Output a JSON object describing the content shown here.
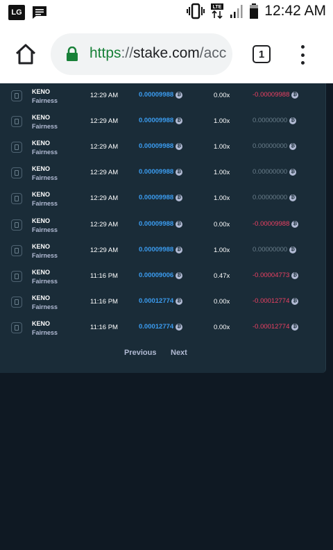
{
  "statusbar": {
    "lg_badge": "LG",
    "time": "12:42 AM",
    "icons": [
      "message-icon",
      "vibrate-icon",
      "lte-icon",
      "signal-icon",
      "battery-icon"
    ]
  },
  "browser": {
    "url_scheme": "https",
    "url_sep": "://",
    "url_host": "stake.com",
    "url_path": "/acc",
    "tab_count": "1",
    "icons": [
      "home-icon",
      "lock-icon",
      "tabs-icon",
      "overflow-menu-icon"
    ]
  },
  "colors": {
    "bet_amount": "#3b9cf0",
    "loss": "#ed4163",
    "neutral": "#b1bad3",
    "panel_bg": "#1a2c38",
    "page_bg": "#0f1923"
  },
  "bets": [
    {
      "game": "KENO",
      "link": "Fairness",
      "time": "12:29 AM",
      "amount": "0.00009988",
      "multiplier": "0.00x",
      "payout": "-0.00009988",
      "loss": true
    },
    {
      "game": "KENO",
      "link": "Fairness",
      "time": "12:29 AM",
      "amount": "0.00009988",
      "multiplier": "1.00x",
      "payout": "0.00000000",
      "loss": false
    },
    {
      "game": "KENO",
      "link": "Fairness",
      "time": "12:29 AM",
      "amount": "0.00009988",
      "multiplier": "1.00x",
      "payout": "0.00000000",
      "loss": false
    },
    {
      "game": "KENO",
      "link": "Fairness",
      "time": "12:29 AM",
      "amount": "0.00009988",
      "multiplier": "1.00x",
      "payout": "0.00000000",
      "loss": false
    },
    {
      "game": "KENO",
      "link": "Fairness",
      "time": "12:29 AM",
      "amount": "0.00009988",
      "multiplier": "1.00x",
      "payout": "0.00000000",
      "loss": false
    },
    {
      "game": "KENO",
      "link": "Fairness",
      "time": "12:29 AM",
      "amount": "0.00009988",
      "multiplier": "0.00x",
      "payout": "-0.00009988",
      "loss": true
    },
    {
      "game": "KENO",
      "link": "Fairness",
      "time": "12:29 AM",
      "amount": "0.00009988",
      "multiplier": "1.00x",
      "payout": "0.00000000",
      "loss": false
    },
    {
      "game": "KENO",
      "link": "Fairness",
      "time": "11:16 PM",
      "amount": "0.00009006",
      "multiplier": "0.47x",
      "payout": "-0.00004773",
      "loss": true
    },
    {
      "game": "KENO",
      "link": "Fairness",
      "time": "11:16 PM",
      "amount": "0.00012774",
      "multiplier": "0.00x",
      "payout": "-0.00012774",
      "loss": true
    },
    {
      "game": "KENO",
      "link": "Fairness",
      "time": "11:16 PM",
      "amount": "0.00012774",
      "multiplier": "0.00x",
      "payout": "-0.00012774",
      "loss": true
    }
  ],
  "pagination": {
    "previous_label": "Previous",
    "next_label": "Next"
  }
}
